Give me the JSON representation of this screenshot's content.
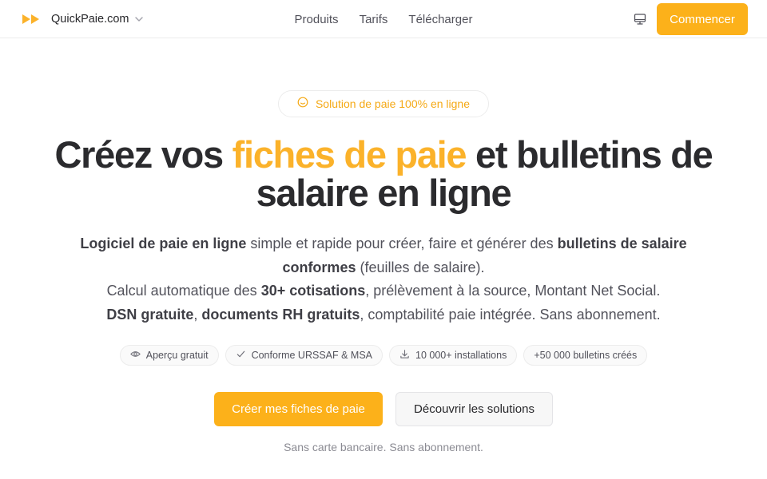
{
  "brand": {
    "name": "QuickPaie.com",
    "accent": "#fbb22a"
  },
  "nav": [
    {
      "label": "Produits"
    },
    {
      "label": "Tarifs"
    },
    {
      "label": "Télécharger"
    }
  ],
  "header": {
    "cta_label": "Commencer",
    "theme_icon": "monitor-icon"
  },
  "hero": {
    "badge": "Solution de paie 100% en ligne",
    "title_before": "Créez vos ",
    "title_accent": "fiches de paie",
    "title_after": " et bulletins de salaire en ligne",
    "subtitle": {
      "s1_bold": "Logiciel de paie en ligne",
      "s1_text": " simple et rapide pour créer, faire et générer des ",
      "s1_bold2": "bulletins de salaire conformes",
      "s1_end": " (feuilles de salaire).",
      "s2_text": "Calcul automatique des ",
      "s2_bold": "30+ cotisations",
      "s2_end": ", prélèvement à la source, Montant Net Social.",
      "s3_bold": "DSN gratuite",
      "s3_sep": ", ",
      "s3_bold2": "documents RH gratuits",
      "s3_end": ", comptabilité paie intégrée. Sans abonnement."
    },
    "chips": [
      {
        "label": "Aperçu gratuit",
        "icon": "eye-icon"
      },
      {
        "label": "Conforme URSSAF & MSA",
        "icon": "check-icon"
      },
      {
        "label": "10 000+ installations",
        "icon": "download-icon"
      },
      {
        "label": "+50 000 bulletins créés",
        "icon": ""
      }
    ],
    "primary_cta": "Créer mes fiches de paie",
    "secondary_cta": "Découvrir les solutions",
    "footnote": "Sans carte bancaire. Sans abonnement."
  }
}
